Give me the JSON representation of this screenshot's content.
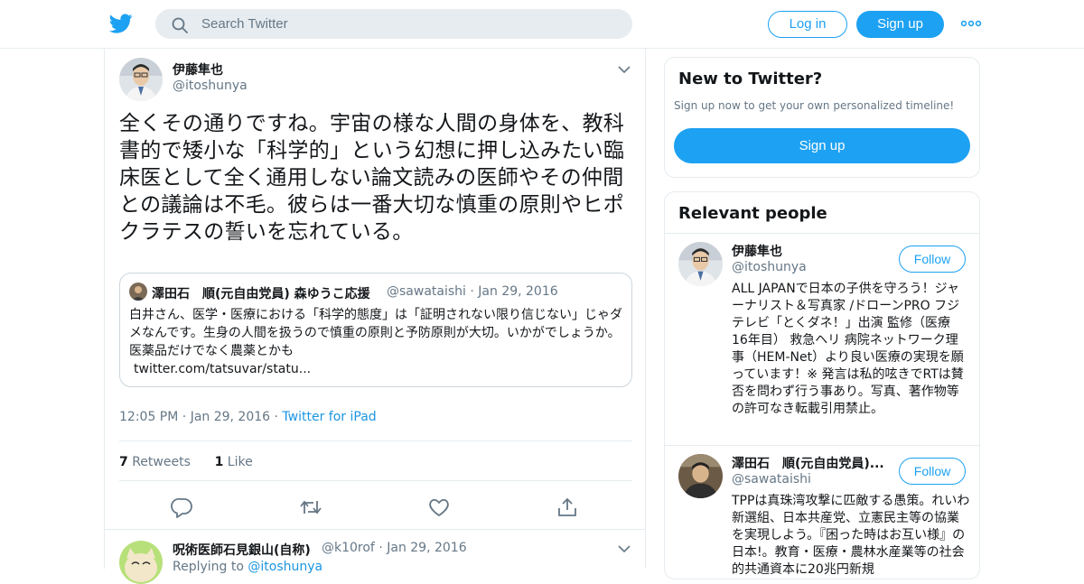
{
  "header": {
    "search_placeholder": "Search Twitter",
    "login_label": "Log in",
    "signup_label": "Sign up",
    "brand_color": "#1da1f2"
  },
  "tweet": {
    "author_name": "伊藤隼也",
    "author_handle": "@itoshunya",
    "text": "全くその通りですね。宇宙の様な人間の身体を、教科書的で矮小な「科学的」という幻想に押し込みたい臨床医として全く通用しない論文読みの医師やその仲間との議論は不毛。彼らは一番大切な慎重の原則やヒポクラテスの誓いを忘れている。",
    "quoted": {
      "author_name": "澤田石　順(元自由党員) 森ゆうこ応援",
      "author_handle": "@sawataishi",
      "date": "Jan 29, 2016",
      "text": "白井さん、医学・医療における「科学的態度」は「証明されない限り信じない」じゃダメなんです。生身の人間を扱うので慎重の原則と予防原則が大切。いかがでしょうか。医薬品だけでなく農薬とかも",
      "link": "twitter.com/tatsuvar/statu..."
    },
    "time": "12:05 PM",
    "date": "Jan 29, 2016",
    "source": "Twitter for iPad",
    "retweets_count": "7",
    "retweets_label": "Retweets",
    "likes_count": "1",
    "likes_label": "Like"
  },
  "reply": {
    "author_name": "呪術医師石見銀山(自称)",
    "author_handle": "@k10rof",
    "date": "Jan 29, 2016",
    "replying_prefix": "Replying to",
    "replying_to": "@itoshunya"
  },
  "sidebar": {
    "new_title": "New to Twitter?",
    "new_subtitle": "Sign up now to get your own personalized timeline!",
    "new_signup_label": "Sign up",
    "relevant_title": "Relevant people",
    "people": [
      {
        "name": "伊藤隼也",
        "handle": "@itoshunya",
        "follow_label": "Follow",
        "bio": "ALL JAPANで日本の子供を守ろう！ジャーナリスト＆写真家 /ドローンPRO フジテレビ「とくダネ！」出演 監修（医療 16年目） 救急ヘリ 病院ネットワーク理事（HEM-Net）より良い医療の実現を願っています！※ 発言は私的呟きでRTは賛否を問わず行う事あり。写真、著作物等の許可なき転載引用禁止。"
      },
      {
        "name": "澤田石　順(元自由党員)...",
        "handle": "@sawataishi",
        "follow_label": "Follow",
        "bio": "TPPは真珠湾攻撃に匹敵する愚策。れいわ新選組、日本共産党、立憲民主等の協業を実現しよう。『困った時はお互い様』の日本!。教育・医療・農林水産業等の社会的共通資本に20兆円新規"
      }
    ]
  }
}
